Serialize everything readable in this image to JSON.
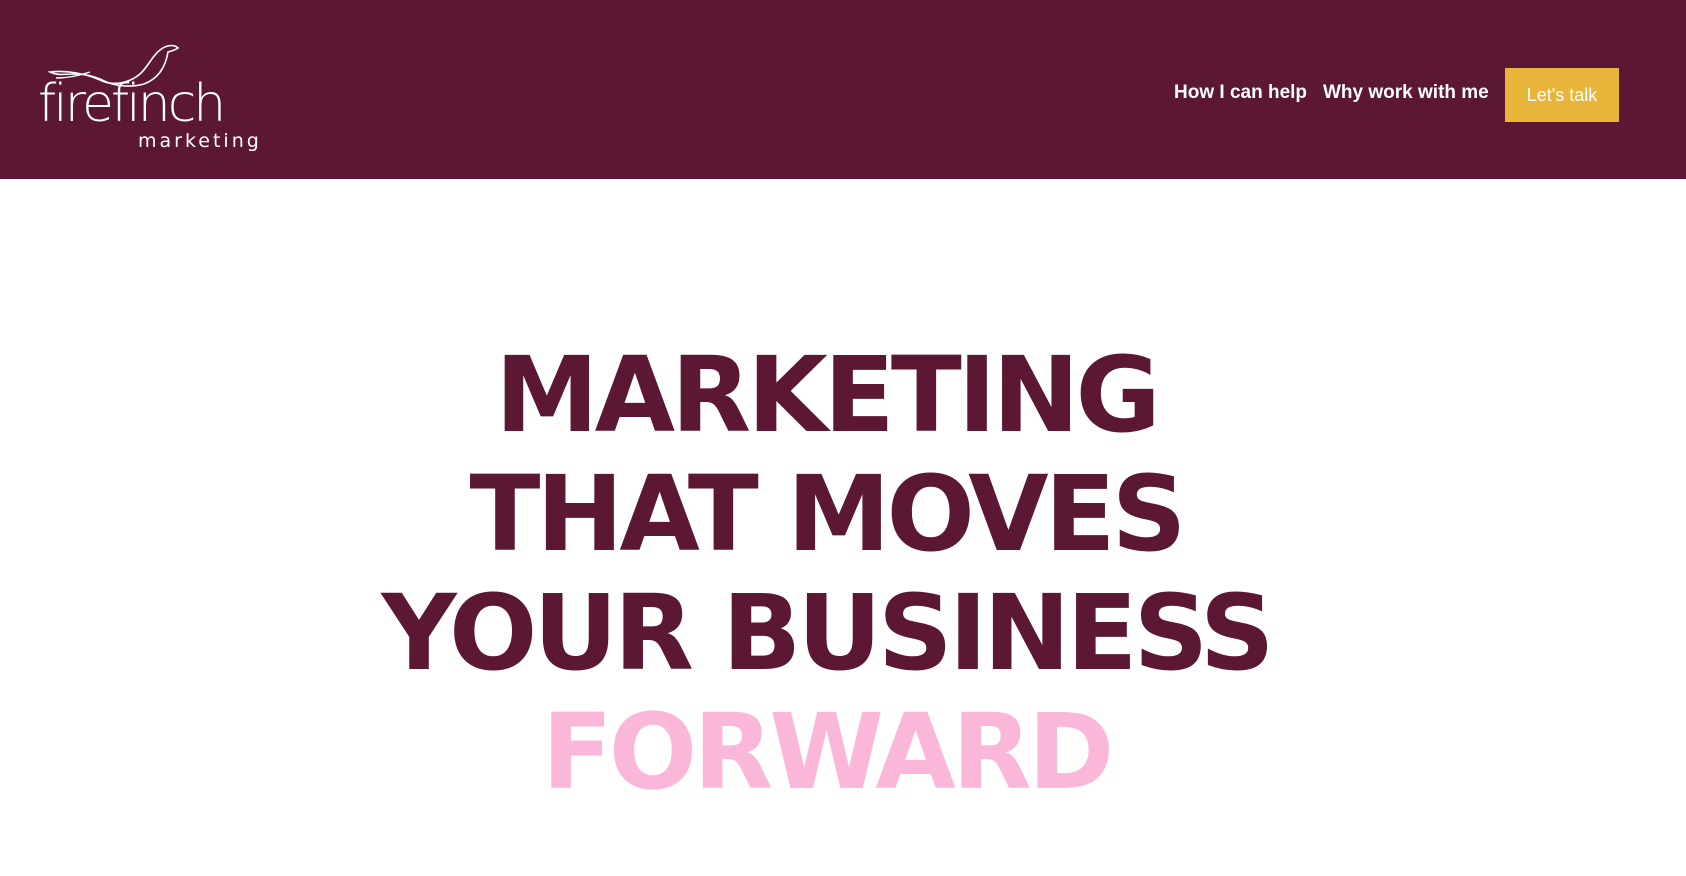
{
  "brand": {
    "name": "firefinch",
    "tagline": "marketing"
  },
  "nav": {
    "links": [
      {
        "label": "How I can help"
      },
      {
        "label": "Why work with me"
      }
    ],
    "cta_label": "Let's talk"
  },
  "hero": {
    "lines": [
      "MARKETING",
      "THAT MOVES",
      "YOUR BUSINESS"
    ],
    "accent_line": "FORWARD"
  },
  "colors": {
    "header_bg": "#5c1734",
    "headline": "#5c1734",
    "accent": "#fbb7d9",
    "cta_bg": "#e8b43a",
    "page_bg": "#ffffff"
  },
  "icons": {
    "logo_bird": "bird-outline-icon"
  }
}
